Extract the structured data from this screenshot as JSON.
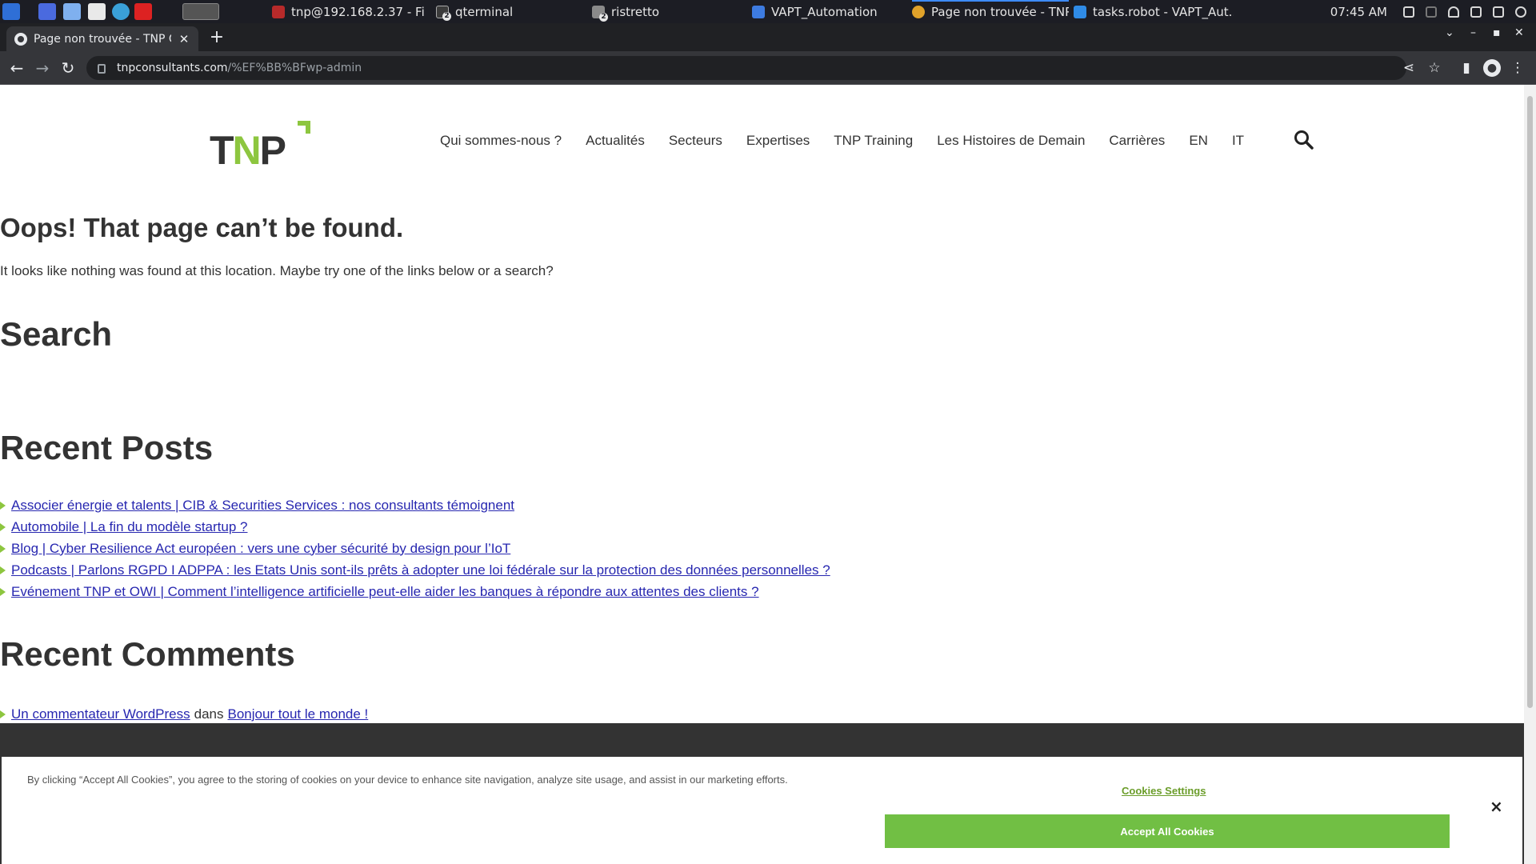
{
  "taskbar": {
    "tasks": [
      {
        "label": "tnp@192.168.2.37 - File...",
        "icon": "filezilla-icon",
        "color": "#b72a2a"
      },
      {
        "label": "qterminal",
        "icon": "terminal-icon",
        "color": "#3b3b3b",
        "badge": "2"
      },
      {
        "label": "ristretto",
        "icon": "image-viewer-icon",
        "color": "#8a8a8a",
        "badge": "2"
      },
      {
        "label": "VAPT_Automation",
        "icon": "folder-icon",
        "color": "#3d7be0"
      },
      {
        "label": "Page non trouvée - TNP ...",
        "icon": "chrome-icon",
        "color": "#e0a22a"
      },
      {
        "label": "tasks.robot - VAPT_Aut...",
        "icon": "vscode-icon",
        "color": "#2f8be6"
      }
    ],
    "clock": "07:45 AM"
  },
  "browser": {
    "tab_title": "Page non trouvée - TNP C",
    "url_host": "tnpconsultants.com",
    "url_path": "/%EF%BB%BFwp-admin"
  },
  "site": {
    "logo_text": "TNP",
    "nav": [
      "Qui sommes-nous ?",
      "Actualités",
      "Secteurs",
      "Expertises",
      "TNP Training",
      "Les Histoires de Demain",
      "Carrières",
      "EN",
      "IT"
    ]
  },
  "content": {
    "heading": "Oops! That page can’t be found.",
    "lead": "It looks like nothing was found at this location. Maybe try one of the links below or a search?",
    "search_heading": "Search",
    "recent_posts_heading": "Recent Posts",
    "recent_posts": [
      "Associer énergie et talents | CIB & Securities Services : nos consultants témoignent",
      "Automobile | La fin du modèle startup ?",
      "Blog | Cyber Resilience Act européen : vers une cyber sécurité by design pour l’IoT",
      "Podcasts | Parlons RGPD I ADPPA : les Etats Unis sont-ils prêts à adopter une loi fédérale sur la protection des données personnelles ?",
      "Evénement TNP et OWI | Comment l’intelligence artificielle peut-elle aider les banques à répondre aux attentes des clients ?"
    ],
    "recent_comments_heading": "Recent Comments",
    "comment_author": "Un commentateur WordPress",
    "comment_connector": "dans",
    "comment_post": "Bonjour tout le monde !"
  },
  "cookie_banner": {
    "text": "By clicking “Accept All Cookies”, you agree to the storing of cookies on your device to enhance site navigation, analyze site usage, and assist in our marketing efforts.",
    "settings_label": "Cookies Settings",
    "accept_label": "Accept All Cookies",
    "close_label": "×"
  },
  "colors": {
    "brand_green": "#8dc63f",
    "accept_green": "#71bf44",
    "link_blue": "#2727b0"
  }
}
